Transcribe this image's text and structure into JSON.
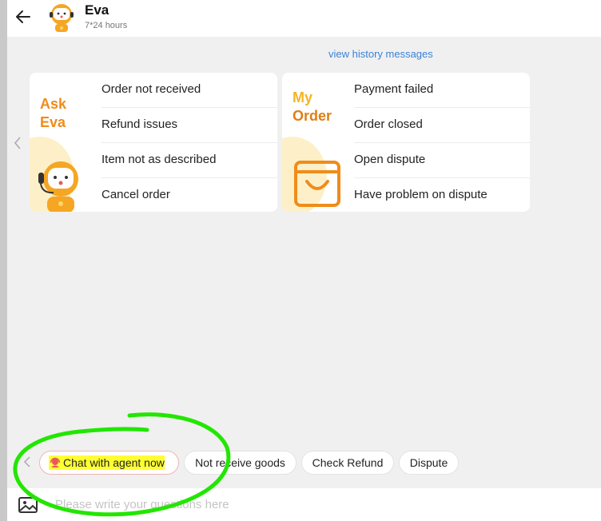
{
  "header": {
    "name": "Eva",
    "subtitle": "7*24 hours"
  },
  "history_link": "view history messages",
  "cards": [
    {
      "title_line1": "Ask",
      "title_line2": "Eva",
      "options": [
        "Order not received",
        "Refund issues",
        "Item not as described",
        "Cancel order"
      ]
    },
    {
      "title_line1": "My",
      "title_line2": "Order",
      "options": [
        "Payment failed",
        "Order closed",
        "Open dispute",
        "Have problem on dispute"
      ]
    }
  ],
  "chips": {
    "agent": "Chat with agent now",
    "not_receive": "Not receive goods",
    "check_refund": "Check Refund",
    "dispute": "Dispute"
  },
  "input": {
    "placeholder": "Please write your questions here"
  },
  "colors": {
    "accent_orange": "#f08c1a",
    "link_blue": "#3b82d8",
    "highlight_yellow": "#ffff33",
    "annotation_green": "#22e600"
  },
  "icons": [
    "back-arrow-icon",
    "robot-avatar-icon",
    "chevron-left-icon",
    "agent-headset-icon",
    "image-upload-icon",
    "shopping-bag-icon"
  ]
}
